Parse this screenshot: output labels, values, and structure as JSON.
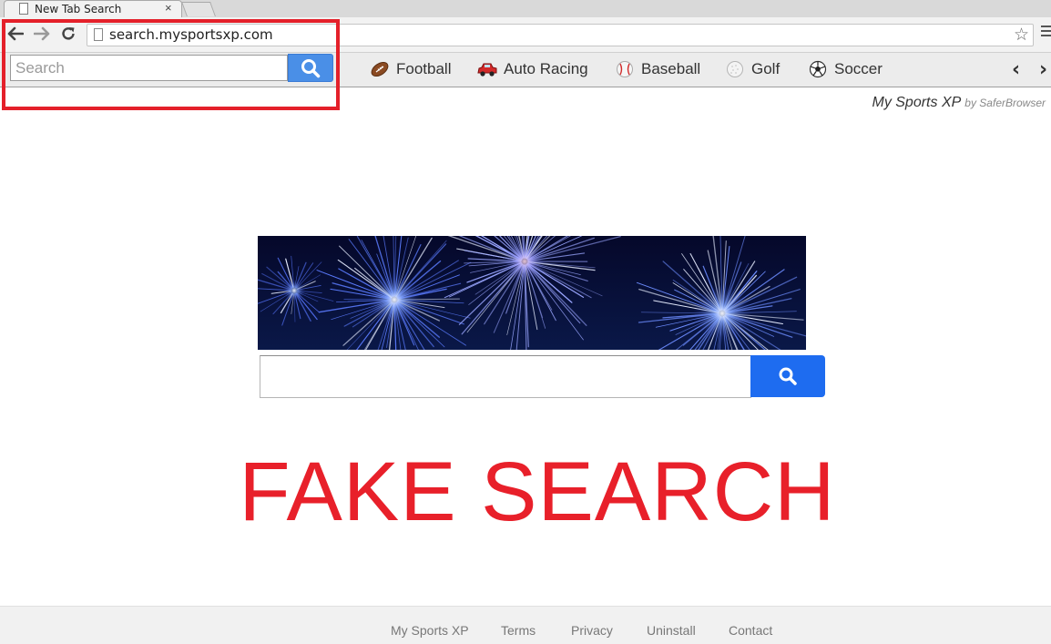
{
  "browser": {
    "tab_title": "New Tab Search",
    "tab_close": "×",
    "url": "search.mysportsxp.com"
  },
  "extension_bar": {
    "search_placeholder": "Search",
    "sports": [
      {
        "label": "Football",
        "icon": "football-icon"
      },
      {
        "label": "Auto Racing",
        "icon": "race-car-icon"
      },
      {
        "label": "Baseball",
        "icon": "baseball-icon"
      },
      {
        "label": "Golf",
        "icon": "golf-ball-icon"
      },
      {
        "label": "Soccer",
        "icon": "soccer-ball-icon"
      }
    ]
  },
  "brand": {
    "name": "My Sports XP",
    "by": "by SaferBrowser"
  },
  "overlay_text": "FAKE SEARCH",
  "footer": {
    "links": [
      "My Sports XP",
      "Terms",
      "Privacy",
      "Uninstall",
      "Contact"
    ]
  },
  "colors": {
    "highlight": "#e4202a",
    "search_button": "#1e6cf0",
    "ext_search_button": "#4a8fe7"
  }
}
